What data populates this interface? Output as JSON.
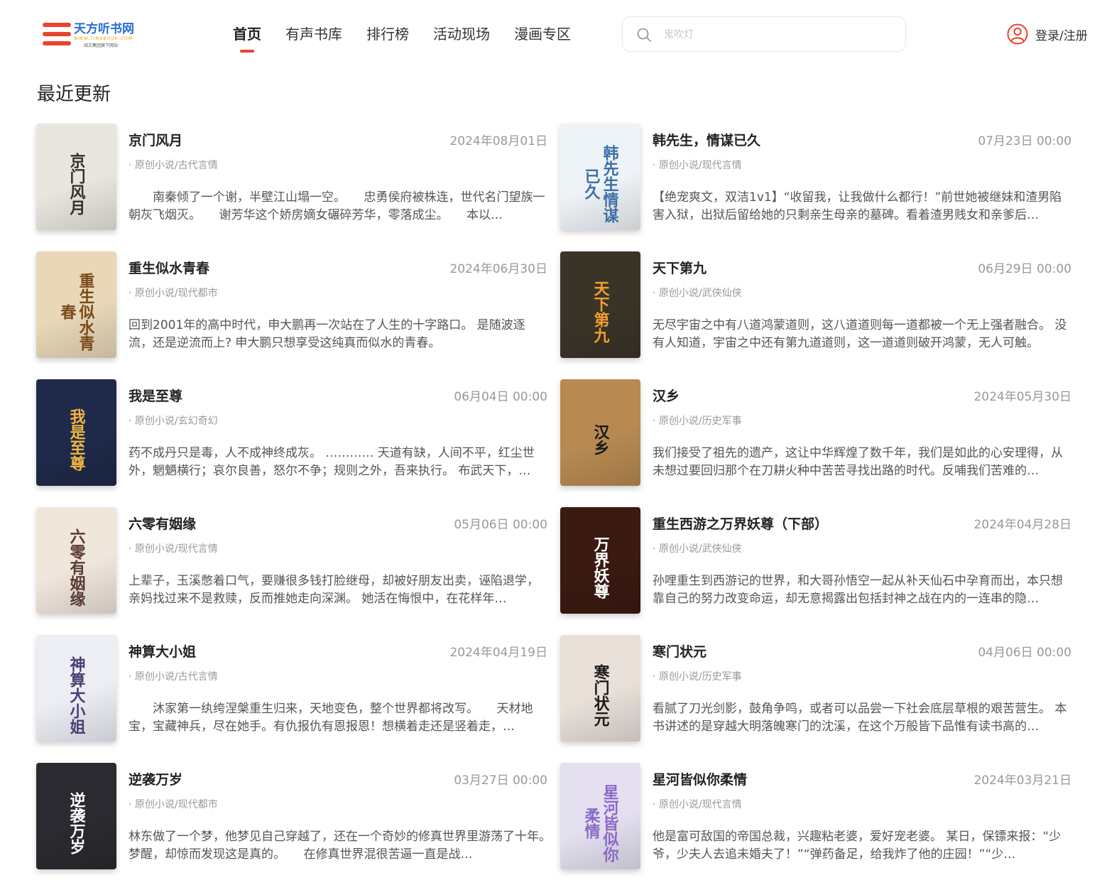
{
  "header": {
    "logo": {
      "title": "天方听书网",
      "url": "WWW.TINGBOOK.COM",
      "tagline": "阅文集团旗下网站"
    },
    "nav": [
      {
        "label": "首页",
        "active": true
      },
      {
        "label": "有声书库",
        "active": false
      },
      {
        "label": "排行榜",
        "active": false
      },
      {
        "label": "活动现场",
        "active": false
      },
      {
        "label": "漫画专区",
        "active": false
      }
    ],
    "search": {
      "placeholder": "鬼吹灯",
      "icon": "search-icon"
    },
    "login": {
      "label": "登录/注册",
      "icon": "user-icon"
    }
  },
  "section": {
    "title": "最近更新"
  },
  "colors": {
    "accent": "#e8442c",
    "text": "#222222",
    "muted": "#999999"
  },
  "books": [
    {
      "title": "京门风月",
      "date": "2024年08月01日",
      "category": "· 原创小说/古代言情",
      "desc": "　　南秦倾了一个谢，半壁江山塌一空。　　忠勇侯府被株连，世代名门望族一朝灰飞烟灭。　　谢芳华这个娇房嫡女碾碎芳华，零落成尘。　　本以…",
      "cover_text": "京门风月",
      "cover_bg": "#e9e6df",
      "cover_fg": "#3a2e2a"
    },
    {
      "title": "韩先生，情谋已久",
      "date": "07月23日 00:00",
      "category": "· 原创小说/现代言情",
      "desc": "【绝宠爽文，双洁1v1】“收留我，让我做什么都行！”前世她被继妹和渣男陷害入狱，出狱后留给她的只剩亲生母亲的墓碑。看着渣男贱女和亲爹后…",
      "cover_text": "韩先生情谋已久",
      "cover_bg": "#eef3f7",
      "cover_fg": "#3d6fa8"
    },
    {
      "title": "重生似水青春",
      "date": "2024年06月30日",
      "category": "· 原创小说/现代都市",
      "desc": "回到2001年的高中时代，申大鹏再一次站在了人生的十字路口。 是随波逐流，还是逆流而上? 申大鹏只想享受这纯真而似水的青春。",
      "cover_text": "重生似水青春",
      "cover_bg": "#e8d8b8",
      "cover_fg": "#7a4a1a"
    },
    {
      "title": "天下第九",
      "date": "06月29日 00:00",
      "category": "· 原创小说/武侠仙侠",
      "desc": "无尽宇宙之中有八道鸿蒙道则，这八道道则每一道都被一个无上强者融合。 没有人知道，宇宙之中还有第九道道则，这一道道则破开鸿蒙，无人可触。",
      "cover_text": "天下第九",
      "cover_bg": "#3a3428",
      "cover_fg": "#f0a030"
    },
    {
      "title": "我是至尊",
      "date": "06月04日 00:00",
      "category": "· 原创小说/玄幻奇幻",
      "desc": "药不成丹只是毒，人不成神终成灰。 ………… 天道有缺，人间不平，红尘世外，魍魉横行；哀尔良善，怒尔不争；规则之外，吾来执行。 布武天下，…",
      "cover_text": "我是至尊",
      "cover_bg": "#1f2a4a",
      "cover_fg": "#f2b640"
    },
    {
      "title": "汉乡",
      "date": "2024年05月30日",
      "category": "· 原创小说/历史军事",
      "desc": "我们接受了祖先的遗产，这让中华辉煌了数千年，我们是如此的心安理得，从未想过要回归那个在刀耕火种中苦苦寻找出路的时代。反哺我们苦难的…",
      "cover_text": "汉乡",
      "cover_bg": "#b88a52",
      "cover_fg": "#1a1a1a"
    },
    {
      "title": "六零有姻缘",
      "date": "05月06日 00:00",
      "category": "· 原创小说/现代言情",
      "desc": "上辈子，玉溪憋着口气，要赚很多钱打脸继母，却被好朋友出卖，诬陷退学，亲妈找过来不是救赎，反而推她走向深渊。 她活在悔恨中，在花样年…",
      "cover_text": "六零有姻缘",
      "cover_bg": "#efe6dc",
      "cover_fg": "#5a3a34"
    },
    {
      "title": "重生西游之万界妖尊（下部）",
      "date": "2024年04月28日",
      "category": "· 原创小说/武侠仙侠",
      "desc": "孙哩重生到西游记的世界，和大哥孙悟空一起从补天仙石中孕育而出，本只想靠自己的努力改变命运，却无意揭露出包括封神之战在内的一连串的隐…",
      "cover_text": "万界妖尊",
      "cover_bg": "#3b1a12",
      "cover_fg": "#ffffff"
    },
    {
      "title": "神算大小姐",
      "date": "2024年04月19日",
      "category": "· 原创小说/古代言情",
      "desc": "　　沐家第一纨绔涅槃重生归来，天地变色，整个世界都将改写。　　天材地宝，宝藏神兵，尽在她手。有仇报仇有恩报恩！想横着走还是竖着走，…",
      "cover_text": "神算大小姐",
      "cover_bg": "#eceef4",
      "cover_fg": "#4a3f74"
    },
    {
      "title": "寒门状元",
      "date": "04月06日 00:00",
      "category": "· 原创小说/历史军事",
      "desc": "看腻了刀光剑影，鼓角争鸣，或者可以品尝一下社会底层草根的艰苦营生。 本书讲述的是穿越大明落魄寒门的沈溪，在这个万般皆下品惟有读书高的…",
      "cover_text": "寒门状元",
      "cover_bg": "#e8dfd8",
      "cover_fg": "#1a1a1a"
    },
    {
      "title": "逆袭万岁",
      "date": "03月27日 00:00",
      "category": "· 原创小说/现代都市",
      "desc": "林东做了一个梦，他梦见自己穿越了，还在一个奇妙的修真世界里游荡了十年。　　梦醒，却惊而发现这是真的。　　在修真世界混很苦逼一直是战…",
      "cover_text": "逆袭万岁",
      "cover_bg": "#2a2a30",
      "cover_fg": "#ffffff"
    },
    {
      "title": "星河皆似你柔情",
      "date": "2024年03月21日",
      "category": "· 原创小说/现代言情",
      "desc": "他是富可敌国的帝国总裁，兴趣粘老婆，爱好宠老婆。 某日，保镖来报：“少爷，少夫人去追未婚夫了！”“弹药备足，给我炸了他的庄园！”“少…",
      "cover_text": "星河皆似你柔情",
      "cover_bg": "#e4e0f0",
      "cover_fg": "#8a6ac8"
    }
  ]
}
